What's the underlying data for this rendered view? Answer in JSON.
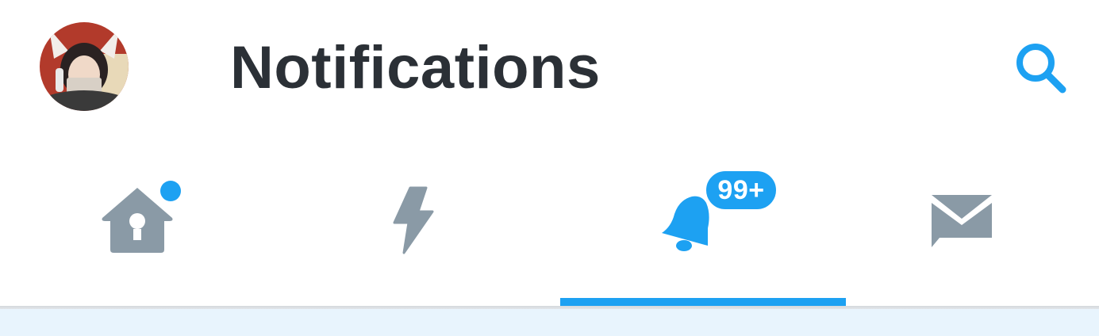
{
  "header": {
    "title": "Notifications",
    "avatar_icon": "profile-avatar",
    "search_icon": "search-icon"
  },
  "tabs": [
    {
      "id": "home",
      "icon": "home-birdhouse-icon",
      "active": false,
      "has_unread_dot": true
    },
    {
      "id": "moments",
      "icon": "lightning-icon",
      "active": false
    },
    {
      "id": "notifications",
      "icon": "bell-icon",
      "active": true,
      "badge": "99+"
    },
    {
      "id": "messages",
      "icon": "envelope-icon",
      "active": false
    }
  ],
  "colors": {
    "accent": "#1da1f2",
    "title_text": "#2b3036",
    "inactive_icon": "#8a9aa6",
    "content_background": "#e8f4fd"
  }
}
